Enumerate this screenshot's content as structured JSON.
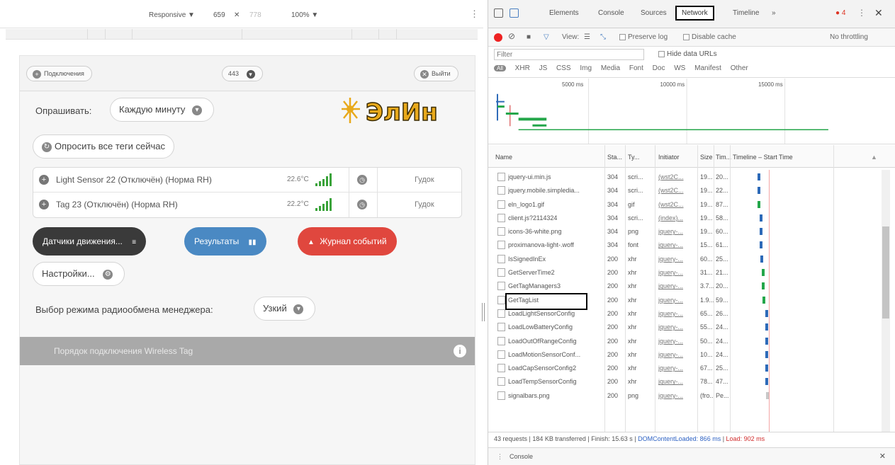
{
  "device_toolbar": {
    "mode": "Responsive ▼",
    "width": "659",
    "times": "✕",
    "height": "778",
    "zoom": "100% ▼",
    "more": "⋮"
  },
  "app": {
    "header": {
      "connect_label": "Подключения",
      "counter": "443",
      "logout_label": "Выйти"
    },
    "poll_label": "Опрашивать:",
    "poll_value": "Каждую минуту",
    "poll_all_button": "Опросить все теги сейчас",
    "logo_text": "ЭлИн",
    "tags": [
      {
        "name": "Light Sensor 22 (Отключён) (Норма RH)",
        "temp": "22.6°C",
        "beep": "Гудок"
      },
      {
        "name": "Tag 23 (Отключён) (Норма RH)",
        "temp": "22.2°C",
        "beep": "Гудок"
      }
    ],
    "buttons": {
      "motion": "Датчики движения...",
      "results": "Результаты",
      "journal": "Журнал событий",
      "settings": "Настройки..."
    },
    "radio_label": "Выбор режима радиообмена менеджера:",
    "radio_value": "Узкий",
    "wireless_label": "Порядок подключения Wireless Tag",
    "info_glyph": "i"
  },
  "devtools": {
    "tabs": [
      "Elements",
      "Console",
      "Sources",
      "Network",
      "Timeline",
      "»"
    ],
    "error_count": "4",
    "toolbar": {
      "view_label": "View:",
      "preserve_log": "Preserve log",
      "disable_cache": "Disable cache",
      "throttling": "No throttling"
    },
    "filter_placeholder": "Filter",
    "hide_data_urls": "Hide data URLs",
    "types": [
      "All",
      "XHR",
      "JS",
      "CSS",
      "Img",
      "Media",
      "Font",
      "Doc",
      "WS",
      "Manifest",
      "Other"
    ],
    "overview_ticks": [
      "5000 ms",
      "10000 ms",
      "15000 ms"
    ],
    "columns": [
      "Name",
      "Sta...",
      "Ty...",
      "Initiator",
      "Size",
      "Tim...",
      "Timeline – Start Time"
    ],
    "sort_arrow": "▲",
    "rows": [
      {
        "name": "jquery-ui.min.js",
        "status": "304",
        "type": "scri...",
        "initiator": "(wst2C...",
        "size": "19...",
        "time": "20...",
        "bar": "blue",
        "bar_ms": 2000
      },
      {
        "name": "jquery.mobile.simpledia...",
        "status": "304",
        "type": "scri...",
        "initiator": "(wst2C...",
        "size": "19...",
        "time": "22...",
        "bar": "blue",
        "bar_ms": 2000
      },
      {
        "name": "eln_logo1.gif",
        "status": "304",
        "type": "gif",
        "initiator": "(wst2C...",
        "size": "19...",
        "time": "87...",
        "bar": "green",
        "bar_ms": 2000
      },
      {
        "name": "client.js?2114324",
        "status": "304",
        "type": "scri...",
        "initiator": "(index)...",
        "size": "19...",
        "time": "58...",
        "bar": "blue",
        "bar_ms": 2200
      },
      {
        "name": "icons-36-white.png",
        "status": "304",
        "type": "png",
        "initiator": "jquery-...",
        "size": "19...",
        "time": "60...",
        "bar": "blue",
        "bar_ms": 2200
      },
      {
        "name": "proximanova-light-.woff",
        "status": "304",
        "type": "font",
        "initiator": "jquery-...",
        "size": "15...",
        "time": "61...",
        "bar": "blue",
        "bar_ms": 2200
      },
      {
        "name": "IsSignedInEx",
        "status": "200",
        "type": "xhr",
        "initiator": "jquery-...",
        "size": "60...",
        "time": "25...",
        "bar": "blue",
        "bar_ms": 2300
      },
      {
        "name": "GetServerTime2",
        "status": "200",
        "type": "xhr",
        "initiator": "jquery-...",
        "size": "31...",
        "time": "21...",
        "bar": "green",
        "bar_ms": 2400
      },
      {
        "name": "GetTagManagers3",
        "status": "200",
        "type": "xhr",
        "initiator": "jquery-...",
        "size": "3.7...",
        "time": "20...",
        "bar": "green",
        "bar_ms": 2400
      },
      {
        "name": "GetTagList",
        "status": "200",
        "type": "xhr",
        "initiator": "jquery-...",
        "size": "1.9...",
        "time": "59...",
        "bar": "green",
        "bar_ms": 2500
      },
      {
        "name": "LoadLightSensorConfig",
        "status": "200",
        "type": "xhr",
        "initiator": "jquery-...",
        "size": "65...",
        "time": "26...",
        "bar": "blue",
        "bar_ms": 2800
      },
      {
        "name": "LoadLowBatteryConfig",
        "status": "200",
        "type": "xhr",
        "initiator": "jquery-...",
        "size": "55...",
        "time": "24...",
        "bar": "blue",
        "bar_ms": 2800
      },
      {
        "name": "LoadOutOfRangeConfig",
        "status": "200",
        "type": "xhr",
        "initiator": "jquery-...",
        "size": "50...",
        "time": "24...",
        "bar": "blue",
        "bar_ms": 2800
      },
      {
        "name": "LoadMotionSensorConf...",
        "status": "200",
        "type": "xhr",
        "initiator": "jquery-...",
        "size": "10...",
        "time": "24...",
        "bar": "blue",
        "bar_ms": 2800
      },
      {
        "name": "LoadCapSensorConfig2",
        "status": "200",
        "type": "xhr",
        "initiator": "jquery-...",
        "size": "67...",
        "time": "25...",
        "bar": "blue",
        "bar_ms": 2800
      },
      {
        "name": "LoadTempSensorConfig",
        "status": "200",
        "type": "xhr",
        "initiator": "jquery-...",
        "size": "78...",
        "time": "47...",
        "bar": "blue",
        "bar_ms": 2800
      },
      {
        "name": "signalbars.png",
        "status": "200",
        "type": "png",
        "initiator": "jquery-...",
        "size": "(fro...",
        "time": "Pe...",
        "bar": "dim",
        "bar_ms": 2900
      }
    ],
    "status_bar": {
      "summary": "43 requests | 184 KB transferred | Finish: 15.63 s | ",
      "dom": "DOMContentLoaded: 866 ms",
      "sep": " | ",
      "load": "Load: 902 ms"
    },
    "console_label": "Console",
    "console_close": "✕",
    "colors": {
      "record": "#ee2222",
      "network_box": "#000000",
      "blue_bar": "#2d6ab8",
      "green_bar": "#24a64a"
    }
  }
}
